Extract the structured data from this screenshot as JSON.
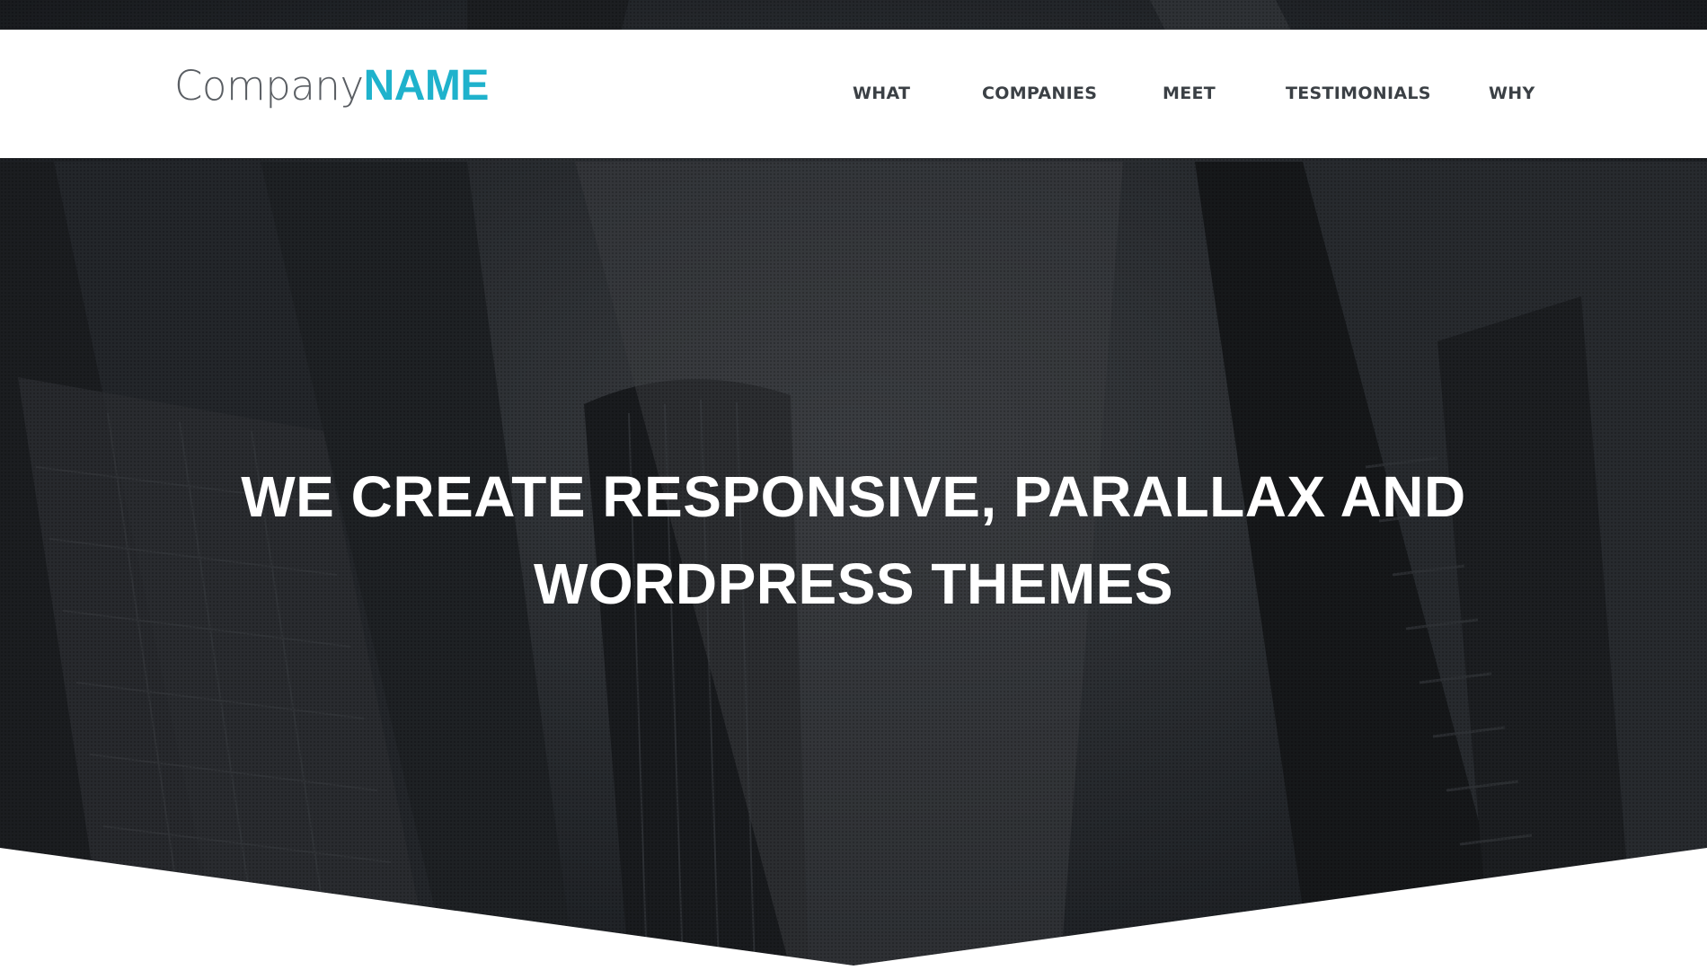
{
  "header": {
    "logo": {
      "light": "Company",
      "bold": "NAME"
    },
    "nav": {
      "what": "WHAT",
      "companies": "COMPANIES",
      "meet": "MEET",
      "testimonials": "TESTIMONIALS",
      "why": "WHY"
    }
  },
  "hero": {
    "title_line1": "WE CREATE RESPONSIVE, PARALLAX AND",
    "title_line2": "WORDPRESS THEMES"
  },
  "colors": {
    "brand_accent": "#1fb2cc",
    "nav_text": "#3b4045",
    "hero_overlay": "#24272b"
  }
}
